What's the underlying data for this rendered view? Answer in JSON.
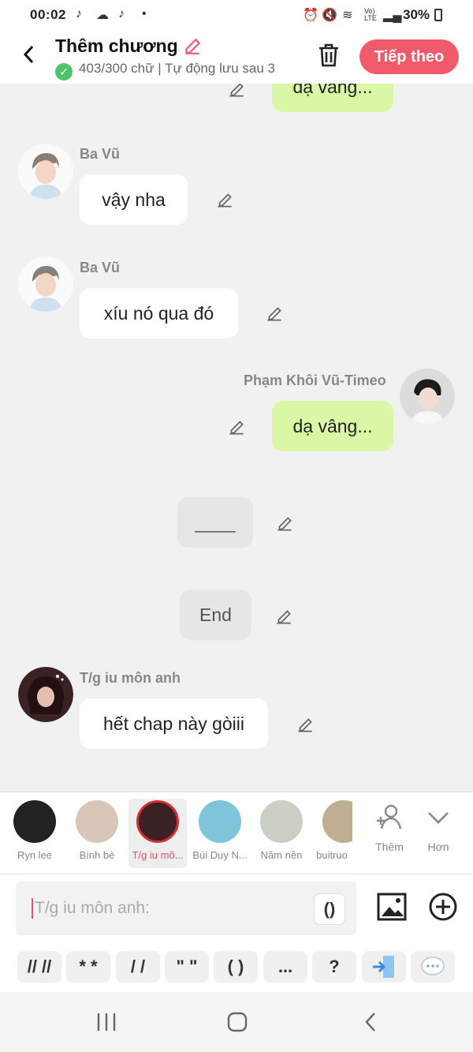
{
  "status_bar": {
    "time": "00:02",
    "battery": "30%"
  },
  "header": {
    "title": "Thêm chương",
    "subtitle": "403/300 chữ | Tự động lưu sau 3",
    "next_label": "Tiếp theo"
  },
  "messages": [
    {
      "side": "right",
      "text": "dạ vâng...",
      "partial": true
    },
    {
      "side": "left",
      "name": "Ba Vũ",
      "text": "vậy nha"
    },
    {
      "side": "left",
      "name": "Ba Vũ",
      "text": "xíu nó qua đó"
    },
    {
      "side": "right",
      "name": "Phạm Khôi Vũ-Timeo",
      "text": "dạ vâng..."
    },
    {
      "side": "center",
      "text": "____"
    },
    {
      "side": "center",
      "text": "End"
    },
    {
      "side": "left",
      "name": "T/g iu môn anh",
      "text": "hết chap này gòiii"
    }
  ],
  "characters": [
    {
      "label": "Ryn lee"
    },
    {
      "label": "Bính bè"
    },
    {
      "label": "T/g iu mô...",
      "selected": true
    },
    {
      "label": "Bùi Duy N..."
    },
    {
      "label": "Năm nền"
    },
    {
      "label": "buitruo"
    }
  ],
  "char_actions": {
    "add_label": "Thêm",
    "more_label": "Hơn"
  },
  "composer": {
    "placeholder": "T/g iu môn anh:",
    "paren_label": "()"
  },
  "shortcuts": [
    "// //",
    "* *",
    "/ /",
    "\" \"",
    "( )",
    "...",
    "?"
  ]
}
